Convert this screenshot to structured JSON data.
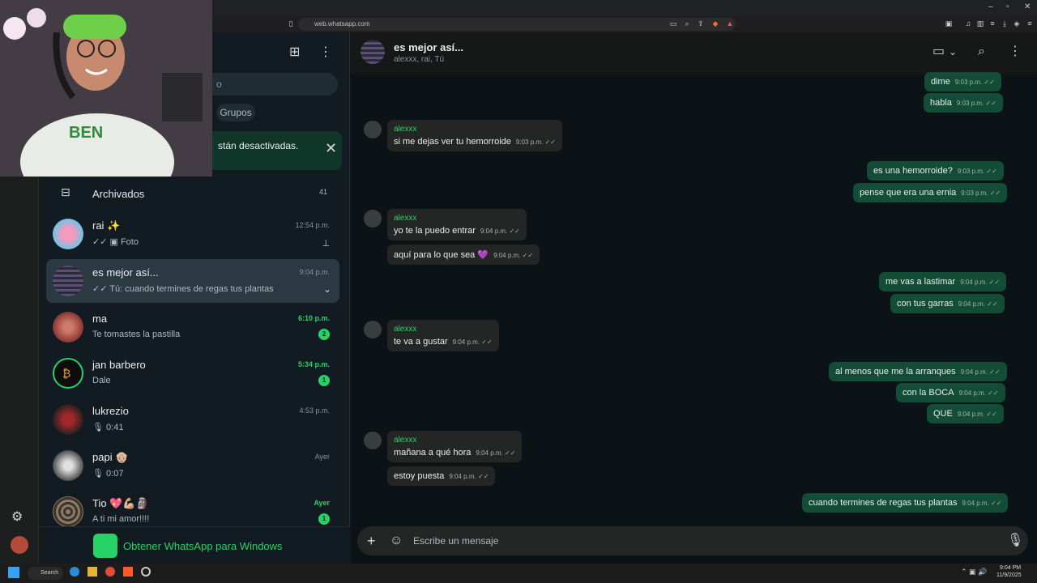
{
  "browser": {
    "url": "web.whatsapp.com",
    "window_controls": [
      "–",
      "▫",
      "✕"
    ]
  },
  "sidebar": {
    "search_placeholder": "o",
    "filter_chip": "Grupos",
    "notice_text": "stán desactivadas.",
    "archived": {
      "label": "Archivados",
      "count": "41"
    },
    "chats": [
      {
        "name": "rai ✨",
        "preview": "✓✓ ▣ Foto",
        "time": "12:54 p.m."
      },
      {
        "name": "es mejor así...",
        "preview": "✓✓ Tú: cuando termines de regas tus plantas",
        "time": "9:04 p.m."
      },
      {
        "name": "ma",
        "preview": "Te tomastes la pastilla",
        "time": "6:10 p.m.",
        "badge": "2"
      },
      {
        "name": "jan barbero",
        "preview": "Dale",
        "time": "5:34 p.m.",
        "badge": "1"
      },
      {
        "name": "lukrezio",
        "preview": "🎙 0:41",
        "time": "4:53 p.m."
      },
      {
        "name": "papi 👴🏼",
        "preview": "🎙 0:07",
        "time": "Ayer"
      },
      {
        "name": "Tio 💖💪🏼🗿",
        "preview": "A ti mi amor!!!!",
        "time": "Ayer",
        "badge": "1"
      }
    ],
    "get_app": "Obtener WhatsApp para Windows"
  },
  "chat": {
    "title": "es mejor así...",
    "subtitle": "alexxx, rai, Tú",
    "composer_placeholder": "Escribe un mensaje",
    "sender": "alexxx",
    "messages": [
      {
        "text": "dime",
        "time": "9:03 p.m."
      },
      {
        "text": "habla",
        "time": "9:03 p.m."
      },
      {
        "text": "si me dejas ver tu hemorroide",
        "time": "9:03 p.m."
      },
      {
        "text": "es una hemorroide?",
        "time": "9:03 p.m."
      },
      {
        "text": "pense que era una ernia",
        "time": "9:03 p.m."
      },
      {
        "text": "yo te la puedo entrar",
        "time": "9:04 p.m."
      },
      {
        "text": "aquí para lo que sea 💜",
        "time": "9:04 p.m."
      },
      {
        "text": "me vas a lastimar",
        "time": "9:04 p.m."
      },
      {
        "text": "con tus garras",
        "time": "9:04 p.m."
      },
      {
        "text": "te va a gustar",
        "time": "9:04 p.m."
      },
      {
        "text": "al menos que me la arranques",
        "time": "9:04 p.m."
      },
      {
        "text": "con la BOCA",
        "time": "9:04 p.m."
      },
      {
        "text": "QUE",
        "time": "9:04 p.m."
      },
      {
        "text": "mañana a qué hora",
        "time": "9:04 p.m."
      },
      {
        "text": "estoy puesta",
        "time": "9:04 p.m."
      },
      {
        "text": "cuando termines de regas tus plantas",
        "time": "9:04 p.m."
      }
    ]
  },
  "taskbar": {
    "search": "Search",
    "clock_time": "9:04 PM",
    "clock_date": "11/9/2025"
  }
}
